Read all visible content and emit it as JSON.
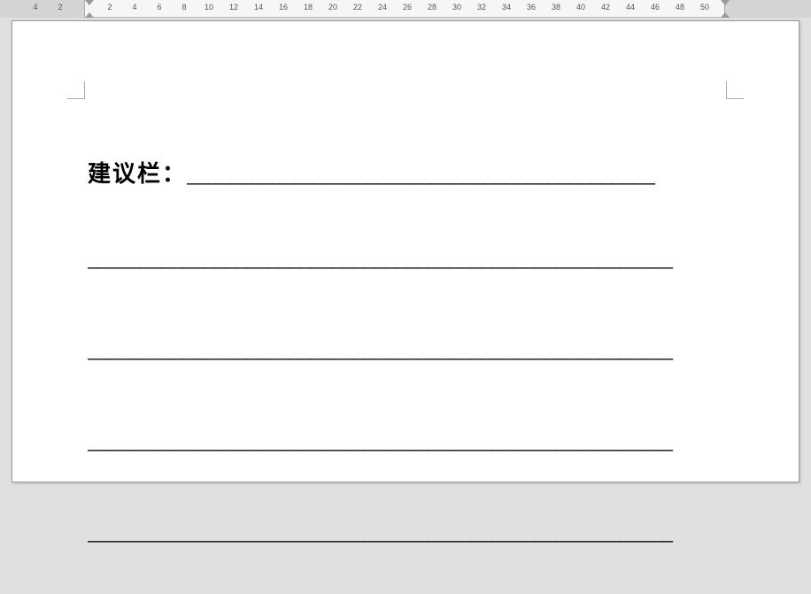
{
  "ruler": {
    "left_numbers": [
      "4",
      "2"
    ],
    "main_numbers": [
      "2",
      "4",
      "6",
      "8",
      "10",
      "12",
      "14",
      "16",
      "18",
      "20",
      "22",
      "24",
      "26",
      "28",
      "30",
      "32",
      "34",
      "36",
      "38",
      "40",
      "42",
      "44",
      "46",
      "48",
      "50"
    ]
  },
  "document": {
    "heading_label": "建议栏：",
    "underline_first": "____________________________________________",
    "full_line_1": "_______________________________________________________",
    "full_line_2": "_______________________________________________________",
    "full_line_3": "_______________________________________________________",
    "full_line_4": "_______________________________________________________"
  }
}
